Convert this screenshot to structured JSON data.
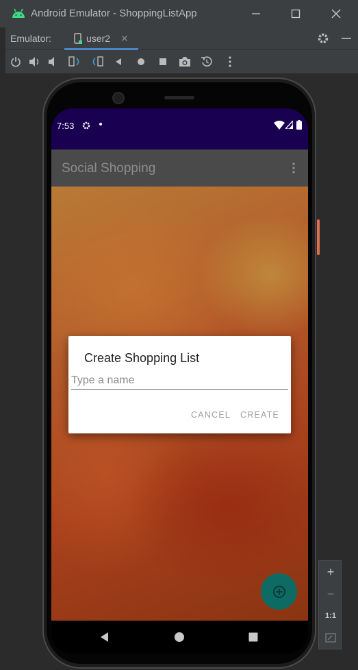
{
  "window": {
    "title": "Android Emulator - ShoppingListApp",
    "icon": "android-icon",
    "controls": [
      "minimize-icon",
      "maximize-icon",
      "close-icon"
    ]
  },
  "tabbar": {
    "label": "Emulator:",
    "active_tab": "user2",
    "settings_icon": "gear-icon",
    "minimize_icon": "minus-icon"
  },
  "toolbar": {
    "icons": [
      "power-icon",
      "volume-up-icon",
      "volume-down-icon",
      "rotate-left-icon",
      "rotate-right-icon",
      "back-icon",
      "home-icon",
      "overview-icon",
      "camera-icon",
      "replay-icon",
      "more-vert-icon"
    ]
  },
  "device": {
    "status_bar": {
      "time": "7:53",
      "color": "#1a0050"
    },
    "app_bar": {
      "title": "Social Shopping",
      "menu_icon": "more-vert-icon"
    },
    "fab": {
      "icon": "add-circle-icon",
      "color": "#0d6b63"
    },
    "nav_bar": [
      "back-triangle-icon",
      "home-circle-icon",
      "recents-square-icon"
    ]
  },
  "dialog": {
    "title": "Create Shopping List",
    "input_placeholder": "Type a name",
    "input_value": "",
    "cancel_label": "CANCEL",
    "create_label": "CREATE"
  },
  "zoom_panel": {
    "zoom_in": "+",
    "zoom_out": "−",
    "actual_size": "1:1",
    "fit_icon": "fit-screen-icon"
  }
}
